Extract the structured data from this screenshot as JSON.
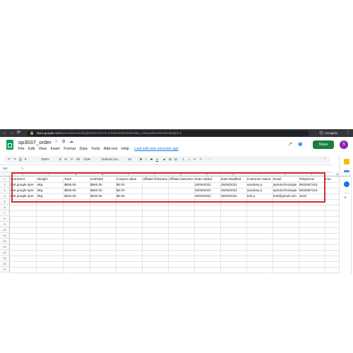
{
  "browser": {
    "nav": [
      "←",
      "→",
      "⟳"
    ],
    "url_host": "docs.google.com",
    "url_path": "/spreadsheets/d/1pbtG0IC103-G-1HNdvsFb6HhSDvMw_mDvpsd5veDHvk/edit#gid=0",
    "profile": "Incognito"
  },
  "doc": {
    "title": "op3037_order",
    "title_icons": "☆ ⧉ ☁",
    "menu": [
      "File",
      "Edit",
      "View",
      "Insert",
      "Format",
      "Data",
      "Tools",
      "Add-ons",
      "Help"
    ],
    "last_edit": "Last edit was seconds ago",
    "share": "Share",
    "avatar": "S"
  },
  "toolbar": {
    "undo": "↶",
    "redo": "↷",
    "print": "⎙",
    "paint": "▾",
    "zoom": "100%",
    "currency": "$",
    "percent": "%",
    "dec1": ".0",
    "dec2": ".00",
    "format": "123▾",
    "font": "Default (Ari...",
    "size": "10",
    "bold": "B",
    "italic": "I",
    "strike": "S",
    "color": "A",
    "more": "⋯",
    "expand": "⌃"
  },
  "formula": {
    "namebox": "I19",
    "fx": "fx"
  },
  "columns": [
    "K",
    "L",
    "M",
    "N",
    "O",
    "P",
    "Q",
    "R",
    "S",
    "T",
    "U",
    "V",
    "W"
  ],
  "rows": [
    "1",
    "2",
    "3",
    "4",
    "5",
    "6",
    "7",
    "8",
    "9",
    "10",
    "11",
    "12",
    "13",
    "14",
    "15",
    "16",
    "17"
  ],
  "headers": [
    "Comment",
    "Weight",
    "Total",
    "SubTotal",
    "Coupon value",
    "Affiliate firstname",
    "Affiliate lastname",
    "Date Added",
    "Date Modified",
    "Customer Name",
    "Email",
    "Telephone",
    "Fax"
  ],
  "data_rows": [
    [
      "test google spre",
      "8kg",
      "$806.00",
      "$660.00",
      "$0.00",
      "",
      "",
      "25/06/2021",
      "25/06/2021",
      "sandeep p",
      "sprixtechnologie",
      "9632587415",
      ""
    ],
    [
      "test google spre",
      "8kg",
      "$806.00",
      "$660.00",
      "$0.00",
      "",
      "",
      "25/06/2021",
      "25/06/2021",
      "sandeep p",
      "sprixtechnologie",
      "9632587415",
      ""
    ],
    [
      "test google spre",
      "8kg",
      "$204.00",
      "$160.00",
      "$0.00",
      "",
      "",
      "25/06/2021",
      "25/06/2021",
      "test p",
      "test@gmail.com",
      "3232",
      ""
    ]
  ],
  "colors": {
    "highlight": "#d32f2f",
    "share": "#188038",
    "sheets_logo": "#0f9d58",
    "avatar": "#8e24aa"
  }
}
